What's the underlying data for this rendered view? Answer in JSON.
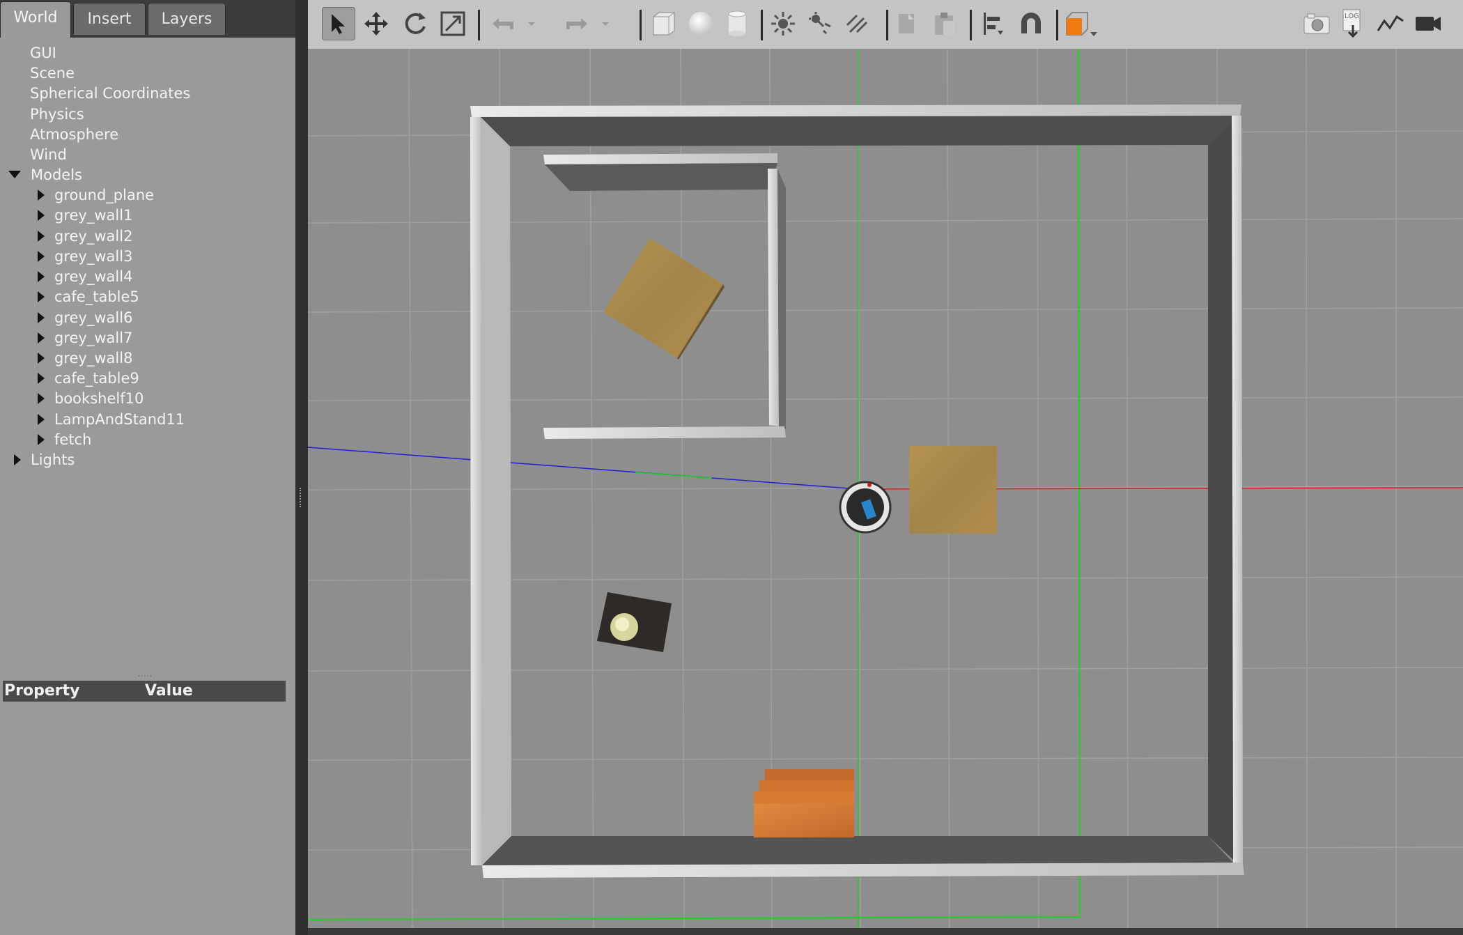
{
  "tabs": {
    "world": "World",
    "insert": "Insert",
    "layers": "Layers"
  },
  "tree": {
    "top_items": [
      "GUI",
      "Scene",
      "Spherical Coordinates",
      "Physics",
      "Atmosphere",
      "Wind"
    ],
    "models_label": "Models",
    "models": [
      "ground_plane",
      "grey_wall1",
      "grey_wall2",
      "grey_wall3",
      "grey_wall4",
      "cafe_table5",
      "grey_wall6",
      "grey_wall7",
      "grey_wall8",
      "cafe_table9",
      "bookshelf10",
      "LampAndStand11",
      "fetch"
    ],
    "lights_label": "Lights"
  },
  "properties": {
    "col_property": "Property",
    "col_value": "Value"
  },
  "toolbar_icons": [
    "select-icon",
    "translate-icon",
    "rotate-icon",
    "scale-icon",
    "undo-icon",
    "undo-history-icon",
    "redo-icon",
    "redo-history-icon",
    "box-shape-icon",
    "sphere-shape-icon",
    "cylinder-shape-icon",
    "point-light-icon",
    "spot-light-icon",
    "directional-light-icon",
    "copy-icon",
    "paste-icon",
    "align-icon",
    "snap-icon",
    "view-angle-icon",
    "screenshot-icon",
    "log-icon",
    "plot-icon",
    "record-video-icon"
  ],
  "colors": {
    "panel": "#9a9a9a",
    "toolbar": "#c4c4c4",
    "ground": "#8e8e8e",
    "grid": "#a2a2a2",
    "axis_x": "#d21e1e",
    "axis_y": "#1ed21e",
    "axis_z": "#1e1ed2",
    "table": "#a8894c",
    "bookshelf": "#d47a34",
    "view_angle": "#f07a10"
  }
}
